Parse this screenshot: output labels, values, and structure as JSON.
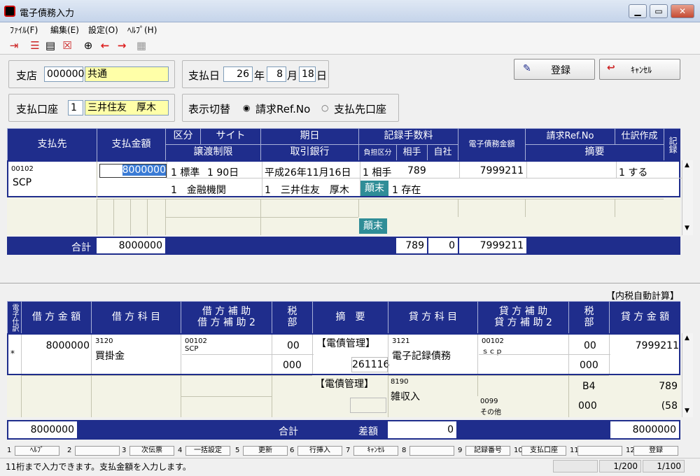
{
  "window": {
    "title": "電子債務入力",
    "minimize": "▁",
    "maximize": "▭",
    "close": "✕"
  },
  "menu": [
    "ﾌｧｲﾙ(F)",
    "編集(E)",
    "設定(O)",
    "ﾍﾙﾌﾟ(H)"
  ],
  "toolbar_icons": [
    "exit-icon",
    "list-icon",
    "print-icon",
    "cancel-doc-icon",
    "zoom-icon",
    "prev-arrow-icon",
    "next-arrow-icon",
    "calculator-icon"
  ],
  "top": {
    "branch_label": "支店",
    "branch_code": "000000",
    "branch_name": "共通",
    "paydate_label": "支払日",
    "pay_year": "26",
    "year_unit": "年",
    "pay_month": "8",
    "month_unit": "月",
    "pay_day": "18",
    "day_unit": "日",
    "account_label": "支払口座",
    "account_code": "1",
    "account_name": "三井住友　厚木",
    "display_label": "表示切替",
    "radio1": "請求Ref.No",
    "radio2": "支払先口座",
    "register_btn": "登録",
    "cancel_btn": "ｷｬﾝｾﾙ"
  },
  "upper_headers": {
    "payee": "支払先",
    "amount": "支払金額",
    "kubun": "区分",
    "site": "サイト",
    "kijitsu": "期日",
    "kiroku_fee": "記録手数料",
    "denshi": "電子債務金額",
    "ref": "請求Ref.No",
    "shiwake": "仕訳作成",
    "kiroku": "記録",
    "joto": "譲渡制限",
    "torihiki": "取引銀行",
    "futan": "負担区分",
    "aite": "相手",
    "jisha": "自社",
    "tekiyo": "摘要"
  },
  "upper_row": {
    "code": "00102",
    "name": "SCP",
    "amount": "8000000",
    "kubun": "1 標準",
    "site": "1 90日",
    "kijitsu": "平成26年11月16日",
    "futan": "1 相手",
    "fee": "789",
    "denshi": "7999211",
    "shiwake": "1 する",
    "joto": "1　金融機関",
    "bank": "1　三井住友　厚木",
    "chomatsu": "顛末",
    "sonzai": "1 存在"
  },
  "upper_row2": {
    "chomatsu": "顛末"
  },
  "upper_total": {
    "label": "合計",
    "amount": "8000000",
    "fee": "789",
    "jisha": "0",
    "denshi": "7999211"
  },
  "auto_tax": "【内税自動計算】",
  "lower_headers": {
    "denshi_shiwake": "電子仕訳",
    "kari_kingaku": "借 方 金 額",
    "kari_kamoku": "借 方 科 目",
    "kari_hojo": "借 方 補 助",
    "kari_hojo2": "借 方 補 助 2",
    "zei": "税",
    "bu": "部",
    "tekiyo": "摘　要",
    "kashi_kamoku": "貸 方 科 目",
    "kashi_hojo": "貸 方 補 助",
    "kashi_hojo2": "貸 方 補 助 2",
    "kashi_kingaku": "貸 方 金 額"
  },
  "lower_row1": {
    "mark": "*",
    "kari_amount": "8000000",
    "kari_code": "3120",
    "kari_name": "買掛金",
    "hojo_code": "00102",
    "hojo_name": "SCP",
    "zei": "00",
    "bu": "000",
    "tekiyo": "【電債管理】",
    "tekiyo_num": "261116",
    "kashi_code": "3121",
    "kashi_name": "電子記録債務",
    "khojo_code": "00102",
    "khojo_name": "ｓｃｐ",
    "kzei": "00",
    "kbu": "000",
    "kashi_amount": "7999211"
  },
  "lower_row2": {
    "tekiyo": "【電債管理】",
    "kashi_code": "8190",
    "kashi_name": "雑収入",
    "khojo_code": "0099",
    "khojo_name": "その他",
    "kzei": "B4",
    "kbu": "000",
    "kashi_amount": "789",
    "kashi_amount2": "(58"
  },
  "lower_total": {
    "kari": "8000000",
    "label": "合計",
    "diff_label": "差額",
    "diff": "0",
    "kashi": "8000000"
  },
  "fkeys": [
    {
      "n": "1",
      "label": "ﾍﾙﾌﾟ"
    },
    {
      "n": "2",
      "label": ""
    },
    {
      "n": "3",
      "label": "次伝票"
    },
    {
      "n": "4",
      "label": "一括設定"
    },
    {
      "n": "5",
      "label": "更新"
    },
    {
      "n": "6",
      "label": "行挿入"
    },
    {
      "n": "7",
      "label": "ｷｬﾝｾﾙ"
    },
    {
      "n": "8",
      "label": ""
    },
    {
      "n": "9",
      "label": "記録番号"
    },
    {
      "n": "10",
      "label": "支払口座"
    },
    {
      "n": "11",
      "label": ""
    },
    {
      "n": "12",
      "label": "登録"
    }
  ],
  "status": {
    "message": "11桁まで入力できます。支払金額を入力します。",
    "page1": "1/200",
    "page2": "1/100"
  }
}
